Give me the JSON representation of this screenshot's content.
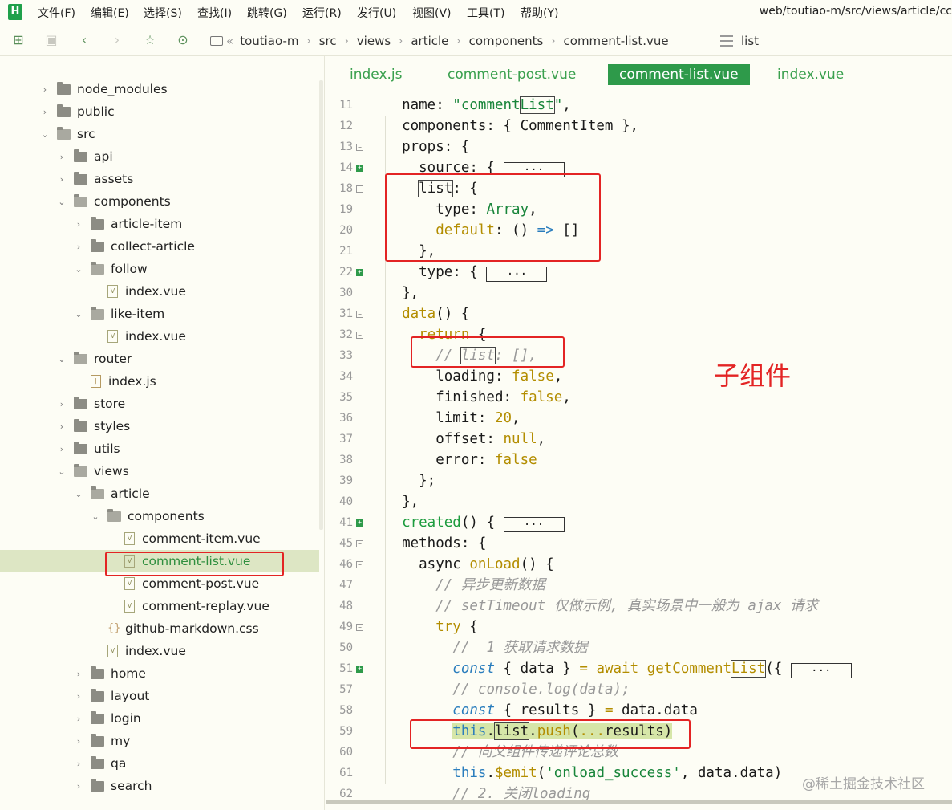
{
  "app": {
    "logo": "H",
    "title": "web/toutiao-m/src/views/article/cc"
  },
  "menu": [
    "文件(F)",
    "编辑(E)",
    "选择(S)",
    "查找(I)",
    "跳转(G)",
    "运行(R)",
    "发行(U)",
    "视图(V)",
    "工具(T)",
    "帮助(Y)"
  ],
  "toolbar": {
    "icons": [
      "new-file-icon",
      "save-icon",
      "back-icon",
      "forward-icon",
      "star-icon",
      "run-icon"
    ],
    "breadcrumb": [
      "toutiao-m",
      "src",
      "views",
      "article",
      "components",
      "comment-list.vue"
    ],
    "breadcrumb_prefix": "«",
    "structure_label": "list"
  },
  "sidebar": {
    "items": [
      {
        "label": "node_modules",
        "depth": 1,
        "type": "folder",
        "expanded": false
      },
      {
        "label": "public",
        "depth": 1,
        "type": "folder",
        "expanded": false
      },
      {
        "label": "src",
        "depth": 1,
        "type": "folder",
        "expanded": true
      },
      {
        "label": "api",
        "depth": 2,
        "type": "folder",
        "expanded": false
      },
      {
        "label": "assets",
        "depth": 2,
        "type": "folder",
        "expanded": false
      },
      {
        "label": "components",
        "depth": 2,
        "type": "folder",
        "expanded": true
      },
      {
        "label": "article-item",
        "depth": 3,
        "type": "folder",
        "expanded": false
      },
      {
        "label": "collect-article",
        "depth": 3,
        "type": "folder",
        "expanded": false
      },
      {
        "label": "follow",
        "depth": 3,
        "type": "folder",
        "expanded": true
      },
      {
        "label": "index.vue",
        "depth": 4,
        "type": "vue"
      },
      {
        "label": "like-item",
        "depth": 3,
        "type": "folder",
        "expanded": true
      },
      {
        "label": "index.vue",
        "depth": 4,
        "type": "vue"
      },
      {
        "label": "router",
        "depth": 2,
        "type": "folder",
        "expanded": true
      },
      {
        "label": "index.js",
        "depth": 3,
        "type": "js"
      },
      {
        "label": "store",
        "depth": 2,
        "type": "folder",
        "expanded": false
      },
      {
        "label": "styles",
        "depth": 2,
        "type": "folder",
        "expanded": false
      },
      {
        "label": "utils",
        "depth": 2,
        "type": "folder",
        "expanded": false
      },
      {
        "label": "views",
        "depth": 2,
        "type": "folder",
        "expanded": true
      },
      {
        "label": "article",
        "depth": 3,
        "type": "folder",
        "expanded": true
      },
      {
        "label": "components",
        "depth": 4,
        "type": "folder",
        "expanded": true
      },
      {
        "label": "comment-item.vue",
        "depth": 5,
        "type": "vue"
      },
      {
        "label": "comment-list.vue",
        "depth": 5,
        "type": "vue",
        "selected": true
      },
      {
        "label": "comment-post.vue",
        "depth": 5,
        "type": "vue"
      },
      {
        "label": "comment-replay.vue",
        "depth": 5,
        "type": "vue"
      },
      {
        "label": "github-markdown.css",
        "depth": 4,
        "type": "css"
      },
      {
        "label": "index.vue",
        "depth": 4,
        "type": "vue"
      },
      {
        "label": "home",
        "depth": 3,
        "type": "folder",
        "expanded": false
      },
      {
        "label": "layout",
        "depth": 3,
        "type": "folder",
        "expanded": false
      },
      {
        "label": "login",
        "depth": 3,
        "type": "folder",
        "expanded": false
      },
      {
        "label": "my",
        "depth": 3,
        "type": "folder",
        "expanded": false
      },
      {
        "label": "qa",
        "depth": 3,
        "type": "folder",
        "expanded": false
      },
      {
        "label": "search",
        "depth": 3,
        "type": "folder",
        "expanded": false
      }
    ]
  },
  "tabs": [
    {
      "label": "index.js",
      "active": false
    },
    {
      "label": "comment-post.vue",
      "active": false
    },
    {
      "label": "comment-list.vue",
      "active": true
    },
    {
      "label": "index.vue",
      "active": false
    }
  ],
  "editor": {
    "lines": [
      {
        "num": "11",
        "fold": "",
        "code": "  name: <span class=\"s\">\"comment<span class=\"hl\">List</span>\"</span>,"
      },
      {
        "num": "12",
        "fold": "",
        "code": "  components: { CommentItem },"
      },
      {
        "num": "13",
        "fold": "minus",
        "code": "  props: {"
      },
      {
        "num": "14",
        "fold": "plus",
        "code": "    source: { <span class=\"collapsed\">...</span>"
      },
      {
        "num": "18",
        "fold": "minus",
        "code": "    <span class=\"hl\">list</span>: {"
      },
      {
        "num": "19",
        "fold": "",
        "code": "      type: <span class=\"s\">Array</span>,"
      },
      {
        "num": "20",
        "fold": "",
        "code": "      <span class=\"o\">default</span>: () <span class=\"k\">=&gt;</span> []"
      },
      {
        "num": "21",
        "fold": "",
        "code": "    },"
      },
      {
        "num": "22",
        "fold": "plus",
        "code": "    type: { <span class=\"collapsed\">...</span>"
      },
      {
        "num": "30",
        "fold": "",
        "code": "  },"
      },
      {
        "num": "31",
        "fold": "minus",
        "code": "  <span class=\"fn\">data</span>() {"
      },
      {
        "num": "32",
        "fold": "minus",
        "code": "    <span class=\"o\">return</span> {"
      },
      {
        "num": "33",
        "fold": "",
        "code": "      <span class=\"c\">// <span class=\"hl\">list</span>: [],</span>"
      },
      {
        "num": "34",
        "fold": "",
        "code": "      loading: <span class=\"o\">false</span>,"
      },
      {
        "num": "35",
        "fold": "",
        "code": "      finished: <span class=\"o\">false</span>,"
      },
      {
        "num": "36",
        "fold": "",
        "code": "      limit: <span class=\"o\">20</span>,"
      },
      {
        "num": "37",
        "fold": "",
        "code": "      offset: <span class=\"o\">null</span>,"
      },
      {
        "num": "38",
        "fold": "",
        "code": "      error: <span class=\"o\">false</span>"
      },
      {
        "num": "39",
        "fold": "",
        "code": "    };"
      },
      {
        "num": "40",
        "fold": "",
        "code": "  },"
      },
      {
        "num": "41",
        "fold": "plus",
        "code": "  <span class=\"g\">created</span>() { <span class=\"collapsed\">...</span>"
      },
      {
        "num": "45",
        "fold": "minus",
        "code": "  methods: {"
      },
      {
        "num": "46",
        "fold": "minus",
        "code": "    async <span class=\"fn\">onLoad</span>() {"
      },
      {
        "num": "47",
        "fold": "",
        "code": "      <span class=\"c\">// 异步更新数据</span>"
      },
      {
        "num": "48",
        "fold": "",
        "code": "      <span class=\"c\">// setTimeout 仅做示例, 真实场景中一般为 ajax 请求</span>"
      },
      {
        "num": "49",
        "fold": "minus",
        "code": "      <span class=\"o\">try</span> {"
      },
      {
        "num": "50",
        "fold": "",
        "code": "        <span class=\"c\">//  1 获取请求数据</span>"
      },
      {
        "num": "51",
        "fold": "plus",
        "code": "        <span class=\"k\" style=\"font-style:italic\">const</span> { data } <span class=\"o\">=</span> <span class=\"o\">await</span> <span class=\"fn\">getComment<span class=\"hl\">List</span></span>({ <span class=\"collapsed\">...</span>"
      },
      {
        "num": "57",
        "fold": "",
        "code": "        <span class=\"c\">// console.log(data);</span>"
      },
      {
        "num": "58",
        "fold": "",
        "code": "        <span class=\"k\" style=\"font-style:italic\">const</span> { results } <span class=\"o\">=</span> data.data"
      },
      {
        "num": "59",
        "fold": "",
        "code": "        <span class=\"push-bg\"><span class=\"k\">this</span>.<span class=\"hl\">list</span>.<span class=\"fn\">push</span>(<span class=\"o\">...</span>results)</span>"
      },
      {
        "num": "60",
        "fold": "",
        "code": "        <span class=\"c\">// 向父组件传递评论总数</span>"
      },
      {
        "num": "61",
        "fold": "",
        "code": "        <span class=\"k\">this</span>.<span class=\"fn\">$emit</span>(<span class=\"s\">'onload_success'</span>, data.data)"
      },
      {
        "num": "62",
        "fold": "",
        "code": "        <span class=\"c\">// 2. 关闭loading</span>"
      }
    ]
  },
  "annotation": {
    "label": "子组件",
    "color": "#e32424"
  },
  "watermark": "@稀土掘金技术社区",
  "colors": {
    "accent": "#2e9a4a",
    "annotation": "#e32424",
    "background": "#fdfdf5"
  }
}
